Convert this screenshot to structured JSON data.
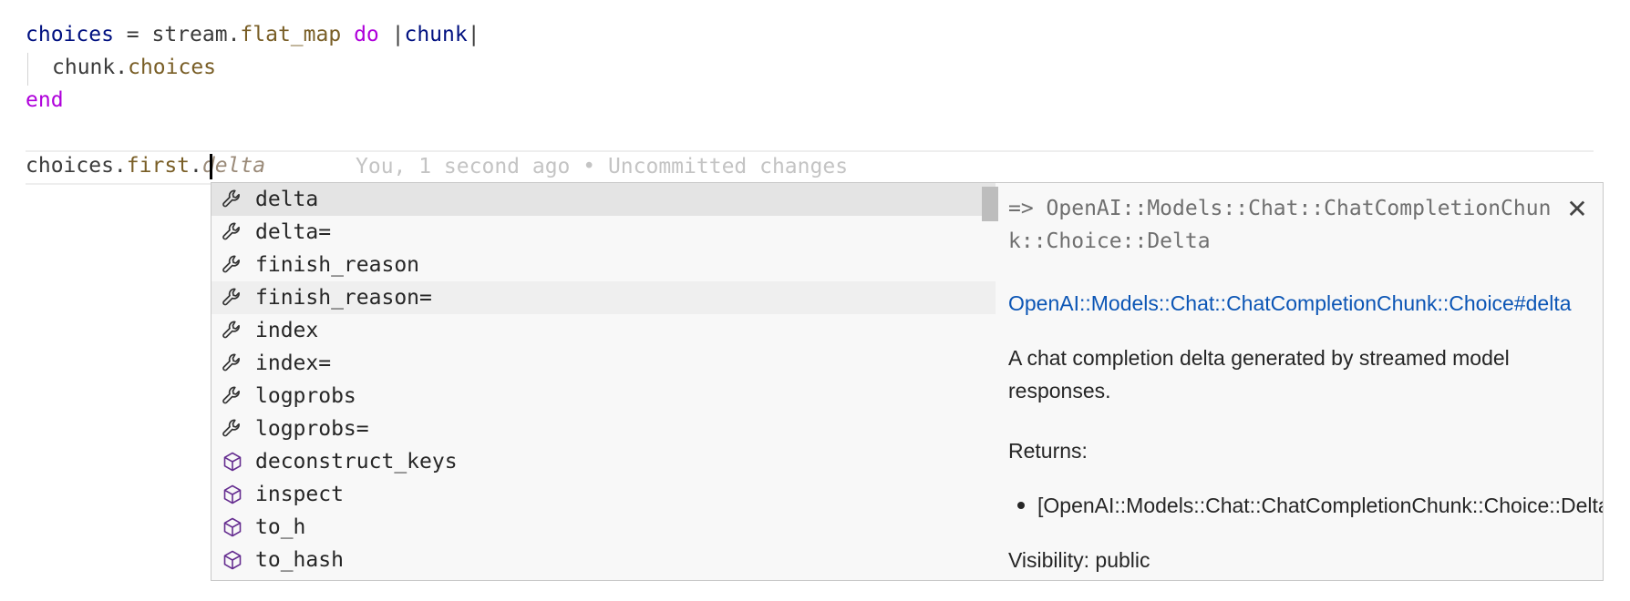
{
  "editor": {
    "line1": {
      "var": "choices",
      "op": " = ",
      "recv": "stream.",
      "method": "flat_map",
      "sp": " ",
      "kw": "do",
      "sp2": " |",
      "param": "chunk",
      "close": "|"
    },
    "line2": {
      "recv": "chunk.",
      "method": "choices"
    },
    "line3": {
      "kw": "end"
    },
    "line5": {
      "recv": "choices.",
      "method": "first",
      "dot": ".",
      "ghost": "delta"
    },
    "blame": "You, 1 second ago • Uncommitted changes"
  },
  "suggestions": [
    {
      "label": "delta",
      "icon": "wrench-icon",
      "state": "selected"
    },
    {
      "label": "delta=",
      "icon": "wrench-icon",
      "state": ""
    },
    {
      "label": "finish_reason",
      "icon": "wrench-icon",
      "state": ""
    },
    {
      "label": "finish_reason=",
      "icon": "wrench-icon",
      "state": "hover"
    },
    {
      "label": "index",
      "icon": "wrench-icon",
      "state": ""
    },
    {
      "label": "index=",
      "icon": "wrench-icon",
      "state": ""
    },
    {
      "label": "logprobs",
      "icon": "wrench-icon",
      "state": ""
    },
    {
      "label": "logprobs=",
      "icon": "wrench-icon",
      "state": ""
    },
    {
      "label": "deconstruct_keys",
      "icon": "cube-icon",
      "state": ""
    },
    {
      "label": "inspect",
      "icon": "cube-icon",
      "state": ""
    },
    {
      "label": "to_h",
      "icon": "cube-icon",
      "state": ""
    },
    {
      "label": "to_hash",
      "icon": "cube-icon",
      "state": ""
    }
  ],
  "details": {
    "signature": "=> OpenAI::Models::Chat::ChatCompletionChunk::Choice::Delta",
    "link": "OpenAI::Models::Chat::ChatCompletionChunk::Choice#delta",
    "description": "A chat completion delta generated by streamed model responses.",
    "returns_label": "Returns:",
    "returns_item": "[OpenAI::Models::Chat::ChatCompletionChunk::Choice::Delta]",
    "visibility": "Visibility: public",
    "close_icon": "close-icon"
  },
  "colors": {
    "wrench": "#333333",
    "cube": "#652d90",
    "link": "#0b55b5"
  }
}
